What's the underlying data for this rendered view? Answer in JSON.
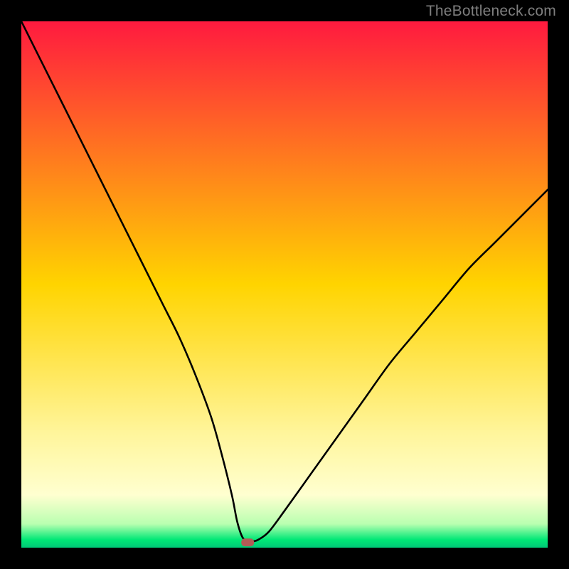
{
  "watermark": "TheBottleneck.com",
  "chart_data": {
    "type": "line",
    "title": "",
    "xlabel": "",
    "ylabel": "",
    "xlim": [
      0,
      100
    ],
    "ylim": [
      0,
      100
    ],
    "grid": false,
    "legend": false,
    "marker": {
      "x": 43,
      "y": 1,
      "color": "#b25b56"
    },
    "background_gradient": {
      "stops": [
        {
          "pos": 0.0,
          "color": "#ff1a3f"
        },
        {
          "pos": 0.5,
          "color": "#ffd400"
        },
        {
          "pos": 0.78,
          "color": "#fff59a"
        },
        {
          "pos": 0.9,
          "color": "#ffffd0"
        },
        {
          "pos": 0.955,
          "color": "#b9ffb0"
        },
        {
          "pos": 0.985,
          "color": "#00e876"
        },
        {
          "pos": 1.0,
          "color": "#00c877"
        }
      ]
    },
    "series": [
      {
        "name": "curve",
        "color": "#000000",
        "x": [
          0,
          3,
          6,
          9,
          12,
          15,
          18,
          21,
          24,
          27,
          30,
          33,
          36,
          38,
          40,
          41,
          42,
          43,
          44,
          45,
          47,
          50,
          55,
          60,
          65,
          70,
          75,
          80,
          85,
          90,
          95,
          100
        ],
        "y": [
          100,
          94,
          88,
          82,
          76,
          70,
          64,
          58,
          52,
          46,
          40,
          33,
          25,
          18,
          10,
          5,
          2,
          1.2,
          1.2,
          1.5,
          3,
          7,
          14,
          21,
          28,
          35,
          41,
          47,
          53,
          58,
          63,
          68
        ]
      }
    ]
  }
}
